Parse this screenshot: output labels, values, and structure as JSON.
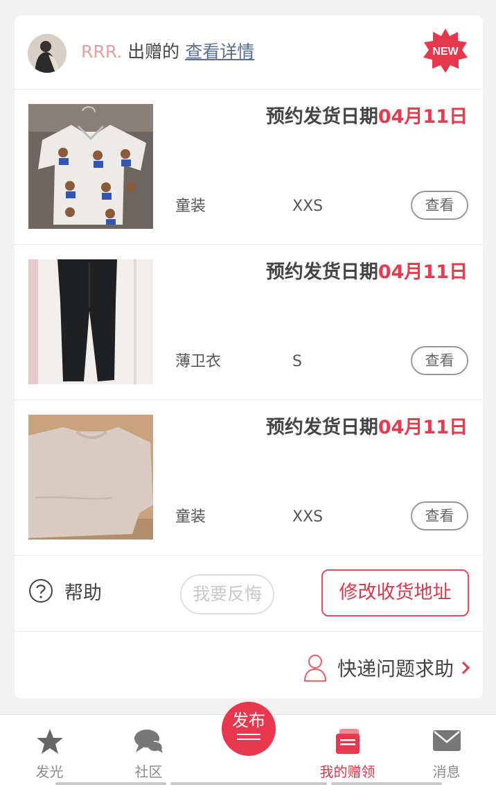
{
  "header": {
    "username": "RRR.",
    "give_text": "出赠的",
    "detail_link": "查看详情",
    "badge": "NEW"
  },
  "items": [
    {
      "ship_label": "预约发货日期",
      "ship_date": "04月11日",
      "category": "童装",
      "size": "XXS",
      "view_label": "查看"
    },
    {
      "ship_label": "预约发货日期",
      "ship_date": "04月11日",
      "category": "薄卫衣",
      "size": "S",
      "view_label": "查看"
    },
    {
      "ship_label": "预约发货日期",
      "ship_date": "04月11日",
      "category": "童装",
      "size": "XXS",
      "view_label": "查看"
    }
  ],
  "actions": {
    "help_label": "帮助",
    "regret_label": "我要反悔",
    "address_label": "修改收货地址"
  },
  "courier": {
    "label": "快递问题求助"
  },
  "tabbar": {
    "tabs": [
      {
        "label": "发光",
        "icon": "star-icon"
      },
      {
        "label": "社区",
        "icon": "chat-icon"
      },
      {
        "label": "我的赠领",
        "icon": "wallet-icon"
      },
      {
        "label": "消息",
        "icon": "mail-icon"
      }
    ],
    "publish_label": "发布"
  },
  "colors": {
    "accent": "#e23c4e",
    "username": "#e3a1a1",
    "link": "#5a6f8f"
  }
}
